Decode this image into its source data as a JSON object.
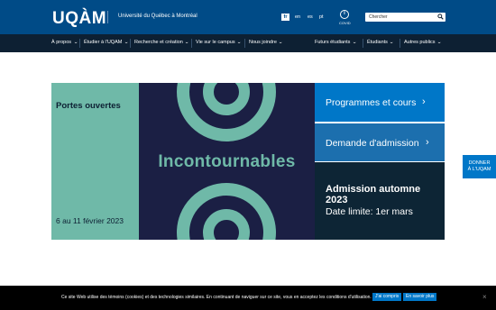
{
  "header": {
    "logo": "UQÀM",
    "university": "Université du Québec à Montréal",
    "languages": [
      "fr",
      "en",
      "es",
      "pt"
    ],
    "covid_label": "COVID",
    "search_placeholder": "Chercher"
  },
  "nav": {
    "items": [
      "À propos",
      "Étudier à l'UQAM",
      "Recherche et création",
      "Vie sur le campus",
      "Nous joindre",
      "Futurs étudiants",
      "Étudiants",
      "Autres publics"
    ]
  },
  "banner": {
    "title": "Portes ouvertes",
    "dates": "6 au 11 février 2023",
    "headline": "Incontournables",
    "programs": "Programmes et cours",
    "admission": "Demande d'admission",
    "automne_title": "Admission automne 2023",
    "automne_date": "Date limite: 1er mars"
  },
  "side_button": {
    "line1": "DONNER",
    "line2": "À L'UQAM"
  },
  "cookie": {
    "text": "Ce site Web utilise des témoins (cookies) et des technologies similaires. En continuant de naviguer sur ce site, vous en acceptez les conditions d'utilisation.",
    "accept": "J'ai compris",
    "more": "En savoir plus",
    "close": "×"
  },
  "colors": {
    "header_blue": "#004b87",
    "nav_dark": "#0d2033",
    "accent_green": "#6fb9a8",
    "dark_navy": "#1b1f44",
    "button_blue": "#0077c8"
  }
}
